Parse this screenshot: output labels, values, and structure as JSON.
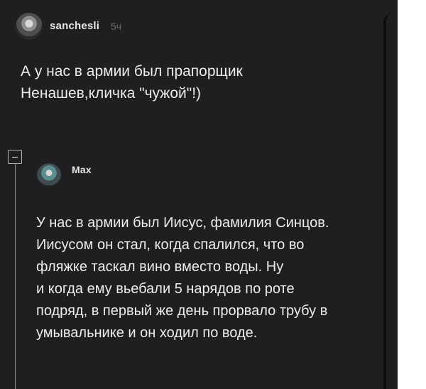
{
  "comments": [
    {
      "author": "sanchesli",
      "time": "5ч",
      "lines": [
        "А у нас в армии был прапорщик",
        "Ненашев,кличка \"чужой\"!)"
      ]
    },
    {
      "author": "Max",
      "lines": [
        "У нас в армии был Иисус, фамилия Синцов.",
        "Иисусом он стал, когда спалился, что во",
        "фляжке таскал вино вместо воды. Ну",
        "и когда ему вьебали 5 нарядов по роте",
        "подряд, в первый же день прорвало трубу в",
        "умывальнике и он ходил по воде."
      ]
    }
  ]
}
